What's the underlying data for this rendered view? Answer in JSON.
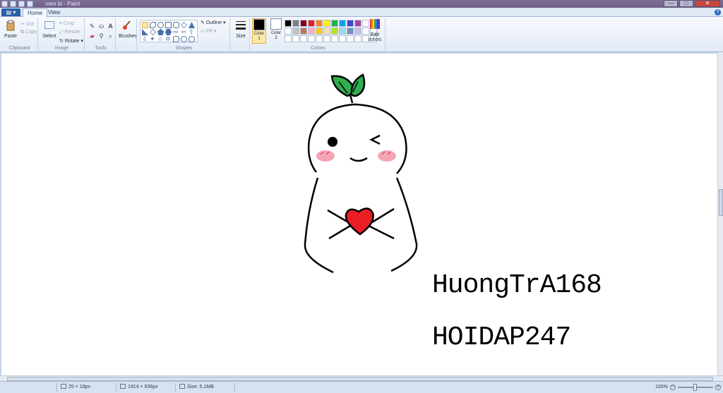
{
  "window": {
    "title": "nem bi - Paint"
  },
  "window_controls": {
    "minimize": "—",
    "maximize": "□",
    "close": "✕"
  },
  "ribbon_tabs": {
    "file_label": "▤ ▾",
    "home": "Home",
    "view": "View",
    "help": "?"
  },
  "clipboard": {
    "paste": "Paste",
    "cut": "Cut",
    "copy": "Copy",
    "group_label": "Clipboard"
  },
  "image": {
    "select": "Select",
    "crop": "Crop",
    "resize": "Resize",
    "rotate": "Rotate",
    "group_label": "Image"
  },
  "tools": {
    "group_label": "Tools"
  },
  "brushes": {
    "label": "Brushes"
  },
  "shapes": {
    "outline": "Outline",
    "fill": "Fill",
    "group_label": "Shapes"
  },
  "size": {
    "label": "Size"
  },
  "colors": {
    "color1_label": "Color 1",
    "color2_label": "Color 2",
    "edit_colors": "Edit colors",
    "group_label": "Colors",
    "color1": "#000000",
    "color2": "#ffffff",
    "palette": [
      "#000000",
      "#7f7f7f",
      "#880015",
      "#ed1c24",
      "#ff7f27",
      "#fff200",
      "#22b14c",
      "#00a2e8",
      "#3f48cc",
      "#a349a4",
      "#ffffff",
      "#ffffff",
      "#ffffff",
      "#c3c3c3",
      "#b97a57",
      "#ffaec9",
      "#ffc90e",
      "#efe4b0",
      "#b5e61d",
      "#99d9ea",
      "#7092be",
      "#c8bfe7",
      "#ffffff",
      "#ffffff",
      "#ffffff",
      "#ffffff",
      "#ffffff",
      "#ffffff",
      "#ffffff",
      "#ffffff",
      "#ffffff",
      "#ffffff",
      "#ffffff",
      "#ffffff",
      "#ffffff",
      "#ffffff"
    ]
  },
  "canvas": {
    "handwriting_line1": "HuongTrA168",
    "handwriting_line2": "HOIDAP247"
  },
  "status_bar": {
    "selection_size": "25 × 18px",
    "image_size": "1914 × 936px",
    "file_size": "Size: 5.1MB",
    "zoom": "100%"
  }
}
